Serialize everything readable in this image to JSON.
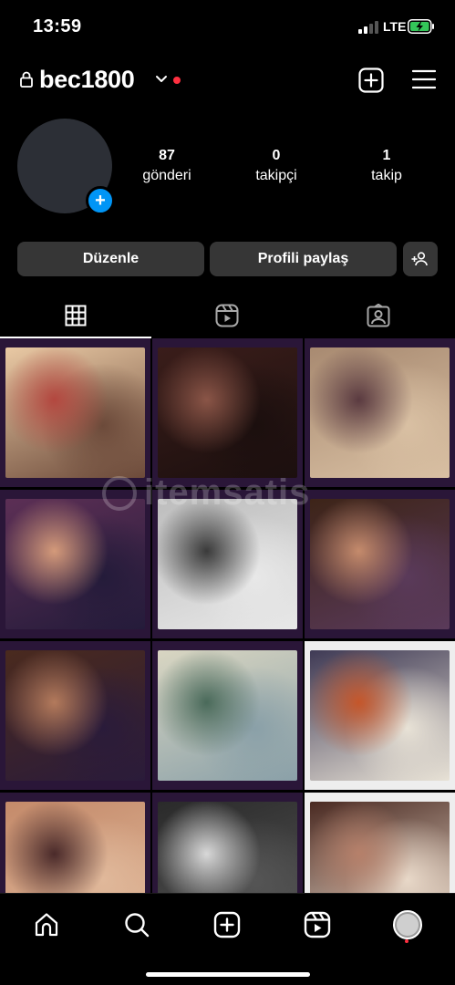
{
  "status_bar": {
    "time": "13:59",
    "network": "LTE"
  },
  "header": {
    "username": "bec1800"
  },
  "profile": {
    "stats": [
      {
        "value": "87",
        "label": "gönderi"
      },
      {
        "value": "0",
        "label": "takipçi"
      },
      {
        "value": "1",
        "label": "takip"
      }
    ]
  },
  "actions": {
    "edit_label": "Düzenle",
    "share_label": "Profili paylaş"
  },
  "tabs": [
    {
      "name": "posts-grid",
      "icon": "grid-icon",
      "active": true
    },
    {
      "name": "reels",
      "icon": "reels-icon",
      "active": false
    },
    {
      "name": "tagged",
      "icon": "tagged-person-icon",
      "active": false
    }
  ],
  "watermark": "itemsatis",
  "grid_posts": [
    {
      "id": 1,
      "palette": [
        "#e9c9a4",
        "#b3473f",
        "#6c4a3a"
      ]
    },
    {
      "id": 2,
      "palette": [
        "#3a1d1a",
        "#8a5547",
        "#1b0f0e"
      ]
    },
    {
      "id": 3,
      "palette": [
        "#a88a71",
        "#5a3a40",
        "#d9c0a3"
      ]
    },
    {
      "id": 4,
      "palette": [
        "#5c2f55",
        "#d49a7a",
        "#241b3a"
      ]
    },
    {
      "id": 5,
      "palette": [
        "#bdbdbd",
        "#3a3a3a",
        "#e8e8e8"
      ]
    },
    {
      "id": 6,
      "palette": [
        "#3d2418",
        "#c58b6c",
        "#5a3a5a"
      ]
    },
    {
      "id": 7,
      "palette": [
        "#4a2a1e",
        "#b37a5c",
        "#2a1b3a"
      ]
    },
    {
      "id": 8,
      "palette": [
        "#d9d6c2",
        "#4a6a5a",
        "#8aa0a8"
      ]
    },
    {
      "id": 9,
      "palette": [
        "#3f3a55",
        "#c5562a",
        "#e8e2d6"
      ]
    },
    {
      "id": 10,
      "palette": [
        "#c48a6a",
        "#4a2a2a",
        "#e0b89a"
      ]
    },
    {
      "id": 11,
      "palette": [
        "#2a2a2a",
        "#d8d8d8",
        "#555"
      ]
    },
    {
      "id": 12,
      "palette": [
        "#4a2a22",
        "#b6806a",
        "#e8d8c8"
      ]
    }
  ],
  "bottom_nav": [
    {
      "name": "home",
      "icon": "home-icon"
    },
    {
      "name": "search",
      "icon": "search-icon"
    },
    {
      "name": "create",
      "icon": "plus-square-icon"
    },
    {
      "name": "reels",
      "icon": "reels-icon"
    },
    {
      "name": "profile",
      "icon": "profile-avatar-icon"
    }
  ]
}
